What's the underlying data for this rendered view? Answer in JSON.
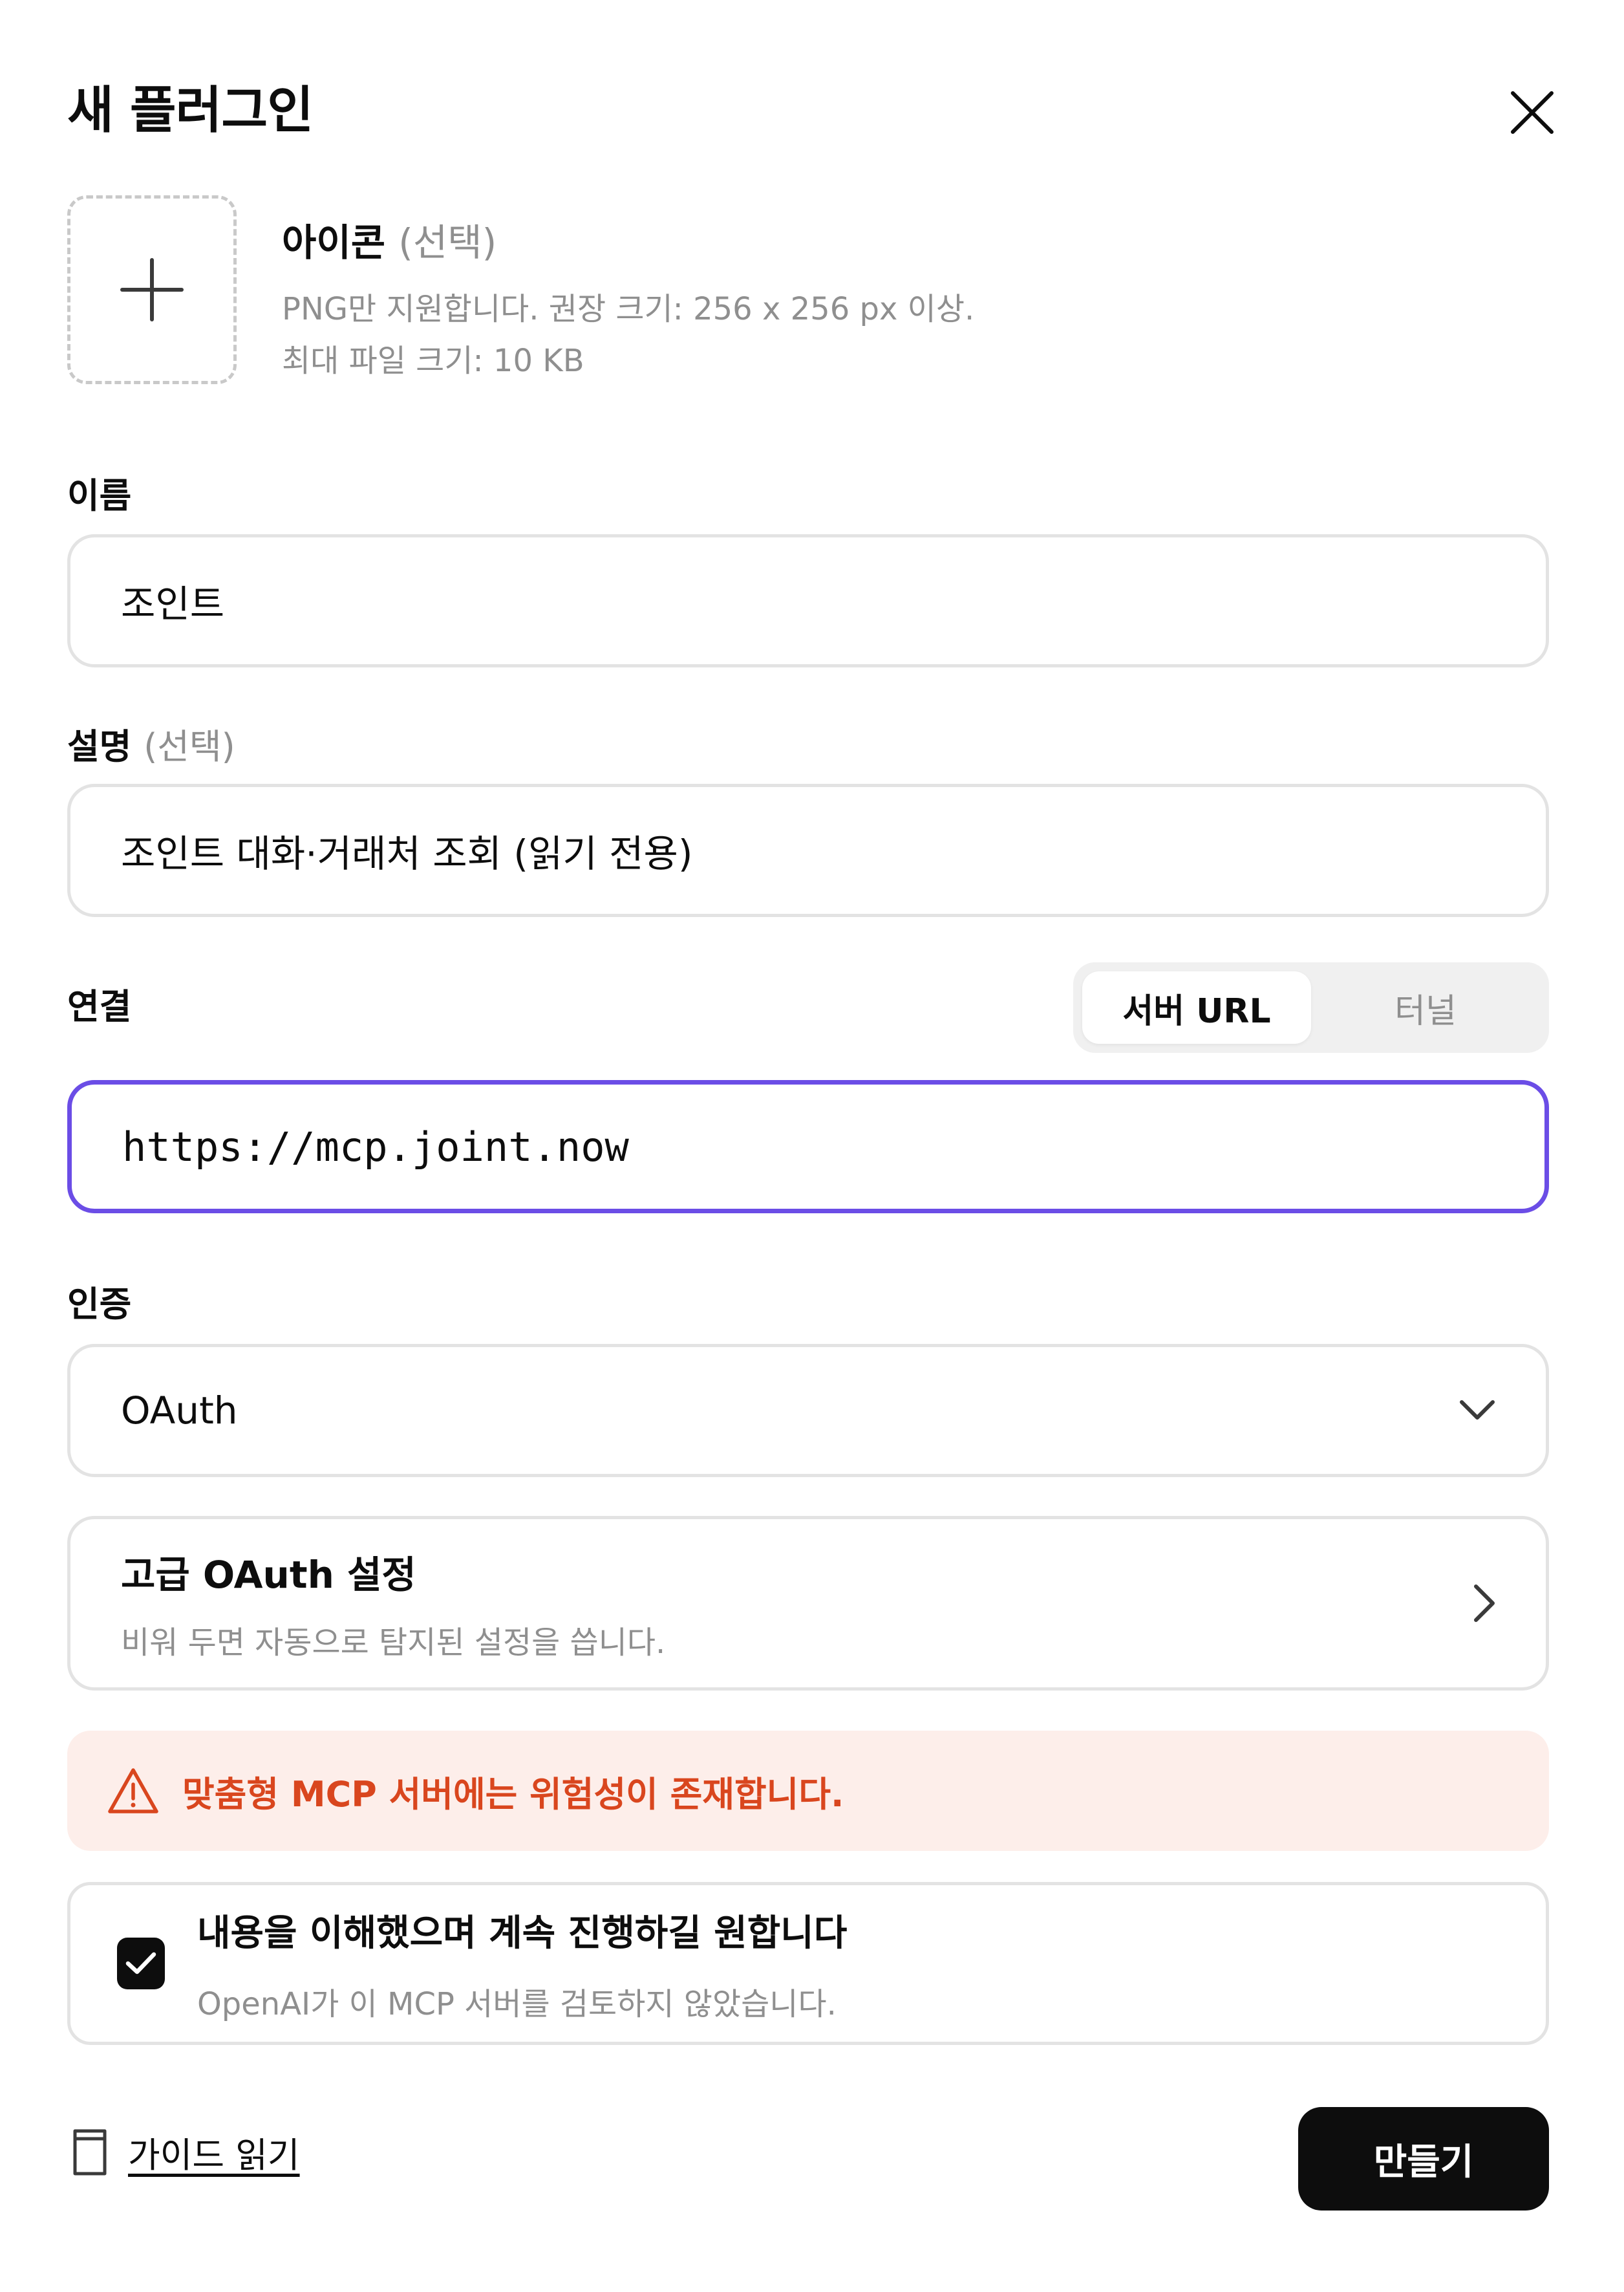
{
  "dialog": {
    "title": "새 플러그인"
  },
  "icon_section": {
    "label": "아이콘",
    "optional": "(선택)",
    "hint_line1": "PNG만 지원합니다. 권장 크기: 256 x 256 px 이상.",
    "hint_line2": "최대 파일 크기: 10 KB"
  },
  "name_field": {
    "label": "이름",
    "value": "조인트"
  },
  "description_field": {
    "label": "설명",
    "optional": "(선택)",
    "value": "조인트 대화·거래처 조회 (읽기 전용)"
  },
  "connection": {
    "label": "연결",
    "tabs": [
      {
        "label": "서버 URL",
        "active": true
      },
      {
        "label": "터널",
        "active": false
      }
    ],
    "url_value": "https://mcp.joint.now"
  },
  "auth": {
    "label": "인증",
    "selected": "OAuth"
  },
  "advanced_oauth": {
    "title": "고급 OAuth 설정",
    "subtitle": "비워 두면 자동으로 탐지된 설정을 씁니다."
  },
  "warning": {
    "text": "맞춤형 MCP 서버에는 위험성이 존재합니다."
  },
  "acknowledge": {
    "checked": true,
    "title": "내용을 이해했으며 계속 진행하길 원합니다",
    "subtitle": "OpenAI가 이 MCP 서버를 검토하지 않았습니다."
  },
  "footer": {
    "guide_label": "가이드 읽기",
    "create_label": "만들기"
  },
  "colors": {
    "accent": "#6b4de6",
    "warning_text": "#d9461e",
    "warning_bg": "#fdeeea",
    "primary_button": "#0d0d0d"
  }
}
